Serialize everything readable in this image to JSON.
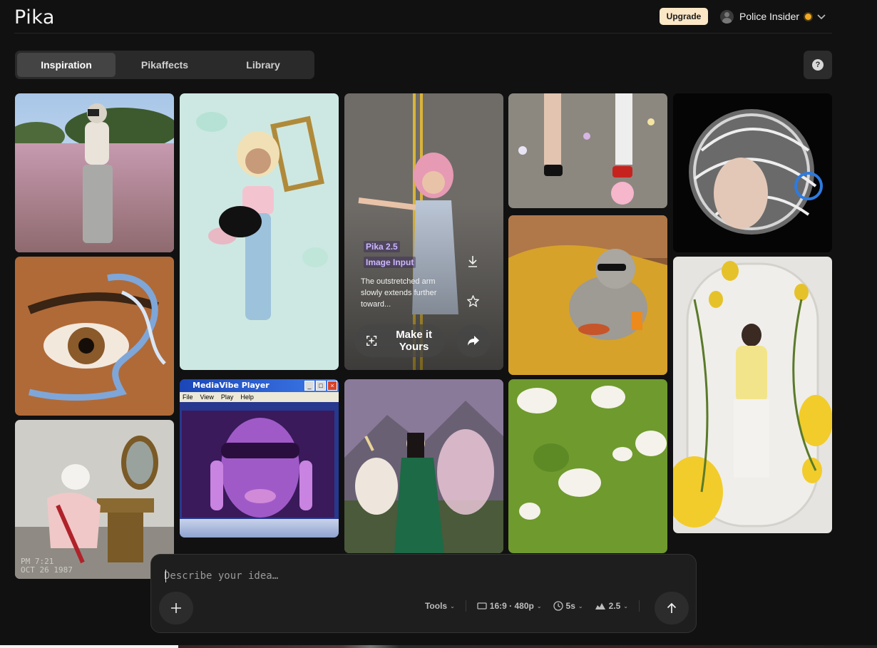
{
  "header": {
    "logo": "Pika",
    "upgrade_label": "Upgrade",
    "user_name": "Police Insider",
    "user_icon": "avatar-icon",
    "menu_icon": "chevron-down-icon"
  },
  "tabs": [
    {
      "label": "Inspiration",
      "active": true
    },
    {
      "label": "Pikaffects",
      "active": false
    },
    {
      "label": "Library",
      "active": false
    }
  ],
  "help_label": "?",
  "gallery": {
    "tile_1": {
      "caption_time": "PM 7:21",
      "caption_date": "OCT 26 1987"
    },
    "hover_card": {
      "model": "Pika 2.5",
      "mode": "Image Input",
      "description": "The outstretched arm slowly extends further toward...",
      "action_label": "Make it Yours",
      "download_icon": "download-icon",
      "favorite_icon": "star-icon",
      "share_icon": "share-icon"
    },
    "media_player": {
      "title": "MediaVibe Player",
      "menu": [
        "File",
        "View",
        "Play",
        "Help"
      ]
    }
  },
  "prompt": {
    "placeholder": "Describe your idea…",
    "tools_label": "Tools",
    "aspect_label": "16:9 · 480p",
    "duration_label": "5s",
    "model_label": "2.5",
    "add_icon": "plus-icon",
    "send_icon": "arrow-up-icon"
  },
  "colors": {
    "background": "#111111",
    "upgrade_bg": "#fbe7c6",
    "accent_tag": "#c9b7ff",
    "status_dot": "#f0a825"
  }
}
